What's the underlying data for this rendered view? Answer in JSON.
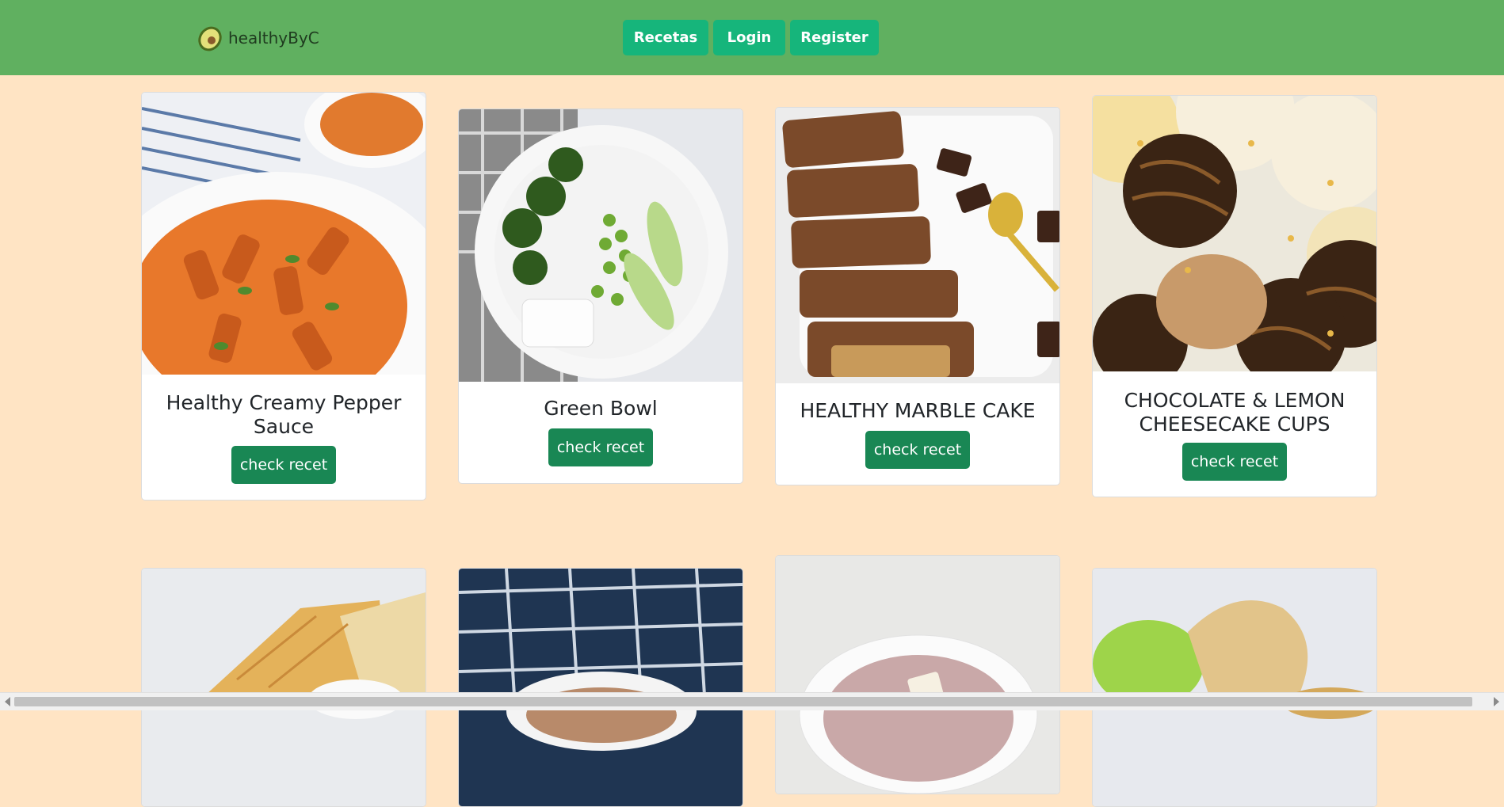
{
  "navbar": {
    "brand": "healthyByC",
    "logo_icon": "avocado-icon",
    "buttons": [
      "Recetas",
      "Login",
      "Register"
    ]
  },
  "recipes": [
    {
      "title": "Healthy Creamy Pepper Sauce",
      "button": "check recet"
    },
    {
      "title": "Green Bowl",
      "button": "check recet"
    },
    {
      "title": "HEALTHY MARBLE CAKE",
      "button": "check recet"
    },
    {
      "title": "CHOCOLATE & LEMON CHEESECAKE CUPS",
      "button": "check recet"
    }
  ],
  "colors": {
    "navbar": "#60b060",
    "page_background": "#ffe4c4",
    "nav_button": "#16b57b",
    "card_button": "#198754"
  }
}
